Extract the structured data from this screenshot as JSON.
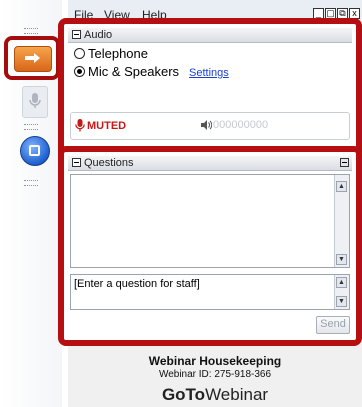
{
  "menu": {
    "file": "File",
    "view": "View",
    "help": "Help"
  },
  "window_controls": {
    "minimize": "_",
    "restore": "▢",
    "fullscreen": "⧉",
    "close": "x"
  },
  "audio": {
    "title": "Audio",
    "option_telephone": "Telephone",
    "option_mic": "Mic & Speakers",
    "selected": "Mic & Speakers",
    "settings_link": "Settings",
    "muted_label": "MUTED",
    "level_meter": "000000000"
  },
  "questions": {
    "title": "Questions",
    "input_placeholder": "[Enter a question for staff]",
    "send_label": "Send"
  },
  "footer": {
    "title": "Webinar Housekeeping",
    "webinar_id": "Webinar ID: 275-918-366",
    "logo_bold": "GoTo",
    "logo_regular": "Webinar"
  },
  "colors": {
    "highlight_frame": "#b50f12",
    "muted": "#c71818",
    "link": "#1a3fd0"
  }
}
